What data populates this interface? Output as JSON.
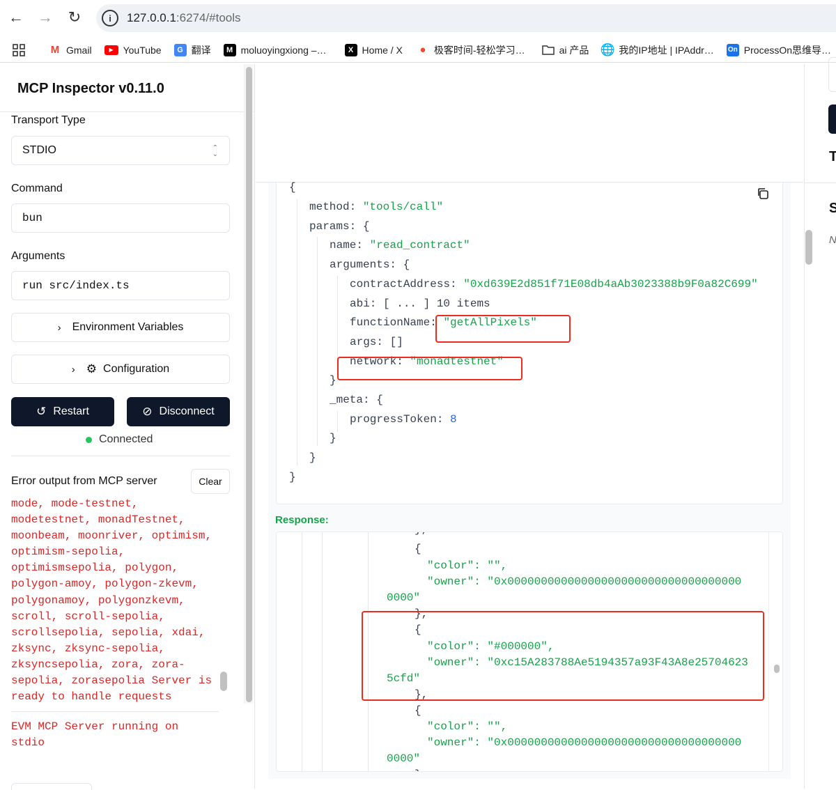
{
  "browser": {
    "url_host": "127.0.0.1",
    "url_rest": ":6274/#tools",
    "bookmarks": [
      {
        "label": "Gmail",
        "icon": "gmail-icon"
      },
      {
        "label": "YouTube",
        "icon": "youtube-icon"
      },
      {
        "label": "翻译",
        "icon": "translate-icon"
      },
      {
        "label": "moluoyingxiong –…",
        "icon": "medium-icon"
      },
      {
        "label": "Home / X",
        "icon": "x-icon"
      },
      {
        "label": "极客时间-轻松学习…",
        "icon": "geektime-icon"
      },
      {
        "label": "ai 产品",
        "icon": "folder-icon"
      },
      {
        "label": "我的IP地址 | IPAddr…",
        "icon": "globe-icon"
      },
      {
        "label": "ProcessOn思维导…",
        "icon": "processon-icon"
      }
    ]
  },
  "sidebar": {
    "title": "MCP Inspector v0.11.0",
    "transport_label": "Transport Type",
    "transport_value": "STDIO",
    "command_label": "Command",
    "command_value": "bun",
    "arguments_label": "Arguments",
    "arguments_value": "run src/index.ts",
    "env_button": "Environment Variables",
    "config_button": "Configuration",
    "restart_button": "Restart",
    "disconnect_button": "Disconnect",
    "status": "Connected",
    "error_title": "Error output from MCP server",
    "clear_button": "Clear",
    "error_entries": [
      "mode, mode-testnet,\nmodetestnet, monadTestnet,\nmoonbeam, moonriver, optimism,\noptimism-sepolia,\noptimismsepolia, polygon,\npolygon-amoy, polygon-zkevm,\npolygonamoy, polygonzkevm,\nscroll, scroll-sepolia,\nscrollsepolia, sepolia, xdai,\nzksync, zksync-sepolia,\nzksyncsepolia, zora, zora-\nsepolia, zorasepolia Server is\nready to handle requests",
      "EVM MCP Server running on\nstdio"
    ]
  },
  "request": {
    "open_brace": "{",
    "method_key": "method:",
    "method_value": "\"tools/call\"",
    "params_key": "params:",
    "name_key": "name:",
    "name_value": "\"read_contract\"",
    "arguments_key": "arguments:",
    "contract_key": "contractAddress:",
    "contract_value": "\"0xd639E2d851f71E08db4aAb3023388b9F0a82C699\"",
    "abi_key": "abi:",
    "abi_value": "[ ... ] 10 items",
    "function_key": "functionName:",
    "function_value": "\"getAllPixels\"",
    "args_key": "args:",
    "args_value": "[]",
    "network_key": "network:",
    "network_value": "\"monadtestnet\"",
    "meta_key": "_meta:",
    "progress_key": "progressToken:",
    "progress_value": "8",
    "close_brace": "}"
  },
  "response": {
    "label": "Response:",
    "lines": [
      "},",
      "{",
      "\"color\": \"\",",
      "\"owner\": \"0x00000000000000000000000000000000000",
      "0000\"",
      "},",
      "{",
      "\"color\": \"#000000\",",
      "\"owner\": \"0xc15A283788Ae5194357a93F43A8e25704623",
      "5cfd\"",
      "},",
      "{",
      "\"color\": \"\",",
      "\"owner\": \"0x00000000000000000000000000000000000",
      "0000\"",
      "}"
    ]
  },
  "right_panel": {
    "t_letter": "T",
    "s_letter": "S",
    "n_letter": "N"
  },
  "colors": {
    "accent_dark": "#0f172a",
    "string_green": "#16a34a",
    "error_red": "#dc2626",
    "highlight_red": "#ef2b20",
    "status_green": "#22c55e"
  }
}
